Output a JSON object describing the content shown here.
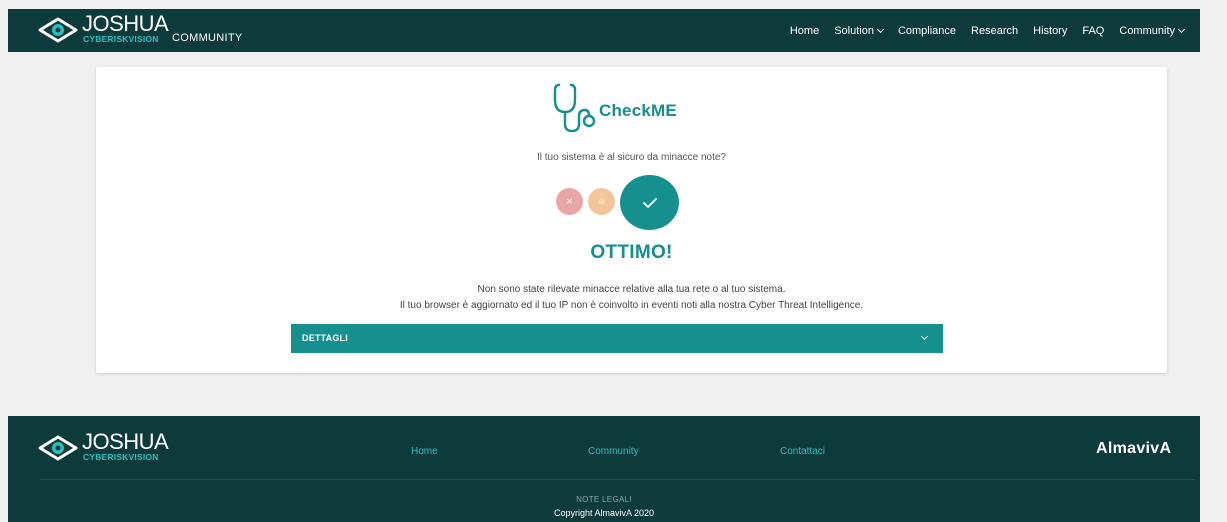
{
  "header": {
    "brand_name": "JOSHUA",
    "brand_sub": "CYBERISKVISION",
    "brand_community": "COMMUNITY",
    "nav": [
      {
        "label": "Home",
        "dropdown": false
      },
      {
        "label": "Solution",
        "dropdown": true
      },
      {
        "label": "Compliance",
        "dropdown": false
      },
      {
        "label": "Research",
        "dropdown": false
      },
      {
        "label": "History",
        "dropdown": false
      },
      {
        "label": "FAQ",
        "dropdown": false
      },
      {
        "label": "Community",
        "dropdown": true
      }
    ]
  },
  "checkme": {
    "logo_text": "CheckME",
    "logo_icon": "stethoscope-icon",
    "question": "Il tuo sistema è al sicuro da minacce note?",
    "status_icons": {
      "red": "x-icon",
      "orange": "minus-circle-icon",
      "green": "check-icon"
    },
    "result_title": "OTTIMO!",
    "message_line1": "Non sono state rilevate minacce relative alla tua rete o al tuo sistema.",
    "message_line2": "Il tuo browser è aggiornato ed il tuo IP non è coinvolto in eventi noti alla nostra Cyber Threat Intelligence.",
    "details_label": "DETTAGLI"
  },
  "footer": {
    "brand_name": "JOSHUA",
    "brand_sub": "CYBERISKVISION",
    "links": [
      "Home",
      "Community",
      "Contattaci"
    ],
    "partner": "AlmavivA",
    "legal": "NOTE LEGALI",
    "copyright": "Copyright AlmavivA 2020"
  },
  "colors": {
    "header_bg": "#0d3b3b",
    "accent": "#168f8f",
    "accent_light": "#2bbfbf",
    "status_red": "#eaa6a6",
    "status_orange": "#f2c59a",
    "page_bg": "#f0f0f0"
  }
}
